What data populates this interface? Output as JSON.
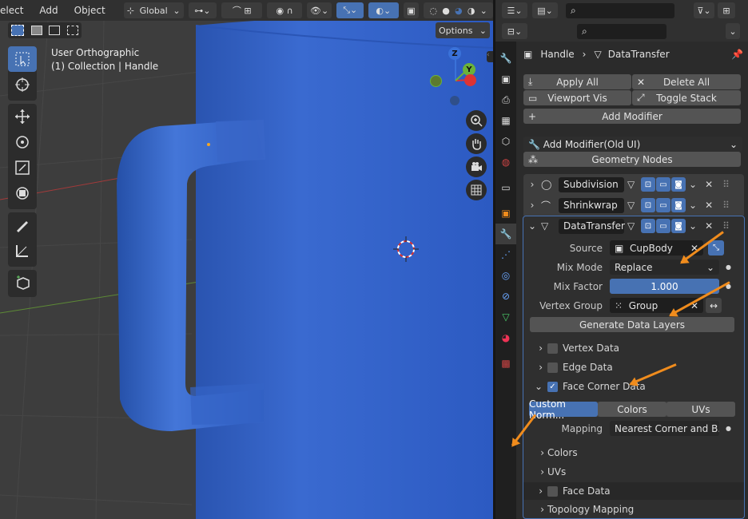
{
  "viewport": {
    "menu": [
      "elect",
      "Add",
      "Object"
    ],
    "orientation": "Global",
    "options_label": "Options",
    "view_name": "User Orthographic",
    "collection_info": "(1) Collection | Handle",
    "gizmo": {
      "z": "Z",
      "y": "Y"
    }
  },
  "properties": {
    "breadcrumb": {
      "object": "Handle",
      "modifier_target": "DataTransfer"
    },
    "buttons": {
      "apply_all": "Apply All",
      "delete_all": "Delete All",
      "viewport_vis": "Viewport Vis",
      "toggle_stack": "Toggle Stack",
      "add_modifier": "Add Modifier",
      "add_modifier_old": "Add Modifier(Old UI)",
      "geometry_nodes": "Geometry Nodes"
    },
    "modifiers": [
      {
        "name": "Subdivision"
      },
      {
        "name": "Shrinkwrap"
      },
      {
        "name": "DataTransfer"
      }
    ],
    "datatransfer": {
      "source_label": "Source",
      "source_value": "CupBody",
      "mix_mode_label": "Mix Mode",
      "mix_mode_value": "Replace",
      "mix_factor_label": "Mix Factor",
      "mix_factor_value": "1.000",
      "vertex_group_label": "Vertex Group",
      "vertex_group_value": "Group",
      "generate_data_layers": "Generate Data Layers",
      "vertex_data": "Vertex Data",
      "edge_data": "Edge Data",
      "face_corner_data": "Face Corner Data",
      "tabs": [
        "Custom Norm...",
        "Colors",
        "UVs"
      ],
      "mapping_label": "Mapping",
      "mapping_value": "Nearest Corner and B...",
      "colors": "Colors",
      "uvs": "UVs",
      "face_data": "Face Data",
      "topology_mapping": "Topology Mapping"
    }
  },
  "colors": {
    "accent": "#4772b3",
    "annotation_arrow": "#f08c1d",
    "mesh_blue": "#2f5fc6"
  }
}
